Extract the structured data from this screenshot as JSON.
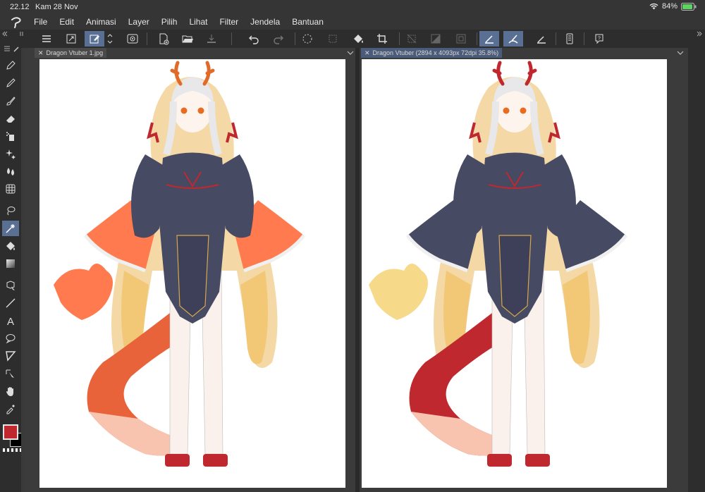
{
  "status_bar": {
    "time": "22.12",
    "date": "Kam 28 Nov",
    "battery": "84%"
  },
  "menu": {
    "items": [
      "File",
      "Edit",
      "Animasi",
      "Layer",
      "Pilih",
      "Lihat",
      "Filter",
      "Jendela",
      "Bantuan"
    ]
  },
  "tabs": [
    {
      "label": "Dragon Vtuber 1.jpg",
      "active": false
    },
    {
      "label": "Dragon Vtuber (2894 x 4093px 72dpi 35.8%)",
      "active": true
    }
  ],
  "colors": {
    "main": "#c0282f",
    "sub": "#000000",
    "accent": "#5a6f94"
  }
}
